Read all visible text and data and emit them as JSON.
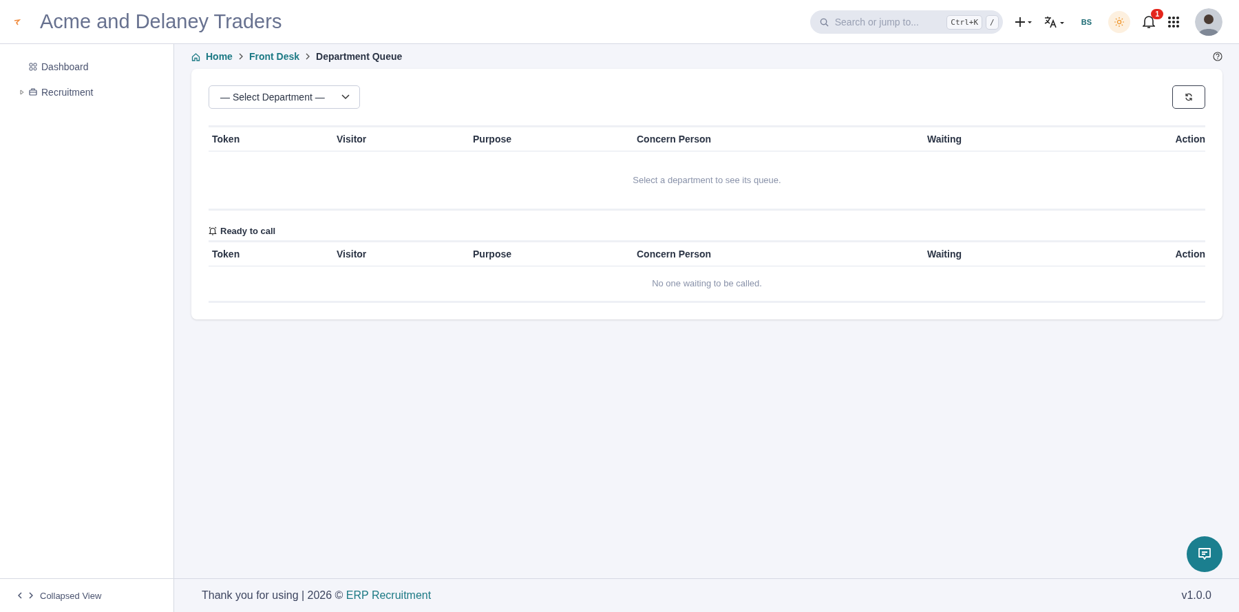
{
  "header": {
    "title": "Acme and Delaney Traders",
    "search": {
      "placeholder": "Search or jump to...",
      "shortcuts": [
        "Ctrl+K",
        "/"
      ]
    },
    "user_initials": "BS",
    "notifications": "1"
  },
  "sidebar": {
    "items": [
      {
        "label": "Dashboard",
        "kind": "link"
      },
      {
        "label": "Recruitment",
        "kind": "group",
        "expanded": false
      }
    ],
    "collapse_label": "Collapsed View"
  },
  "breadcrumb": [
    {
      "label": "Home",
      "kind": "home"
    },
    {
      "label": "Front Desk",
      "kind": "link"
    },
    {
      "label": "Department Queue",
      "kind": "current"
    }
  ],
  "department_select": {
    "placeholder": "— Select Department —"
  },
  "queue_table": {
    "columns": [
      "Token",
      "Visitor",
      "Purpose",
      "Concern Person",
      "Waiting",
      "Action"
    ],
    "empty_message": "Select a department to see its queue."
  },
  "ready_section": {
    "title": "Ready to call",
    "columns": [
      "Token",
      "Visitor",
      "Purpose",
      "Concern Person",
      "Waiting",
      "Action"
    ],
    "empty_message": "No one waiting to be called."
  },
  "footer": {
    "text": "Thank you for using | 2026 ©",
    "link": "ERP Recruitment",
    "version": "v1.0.0"
  }
}
